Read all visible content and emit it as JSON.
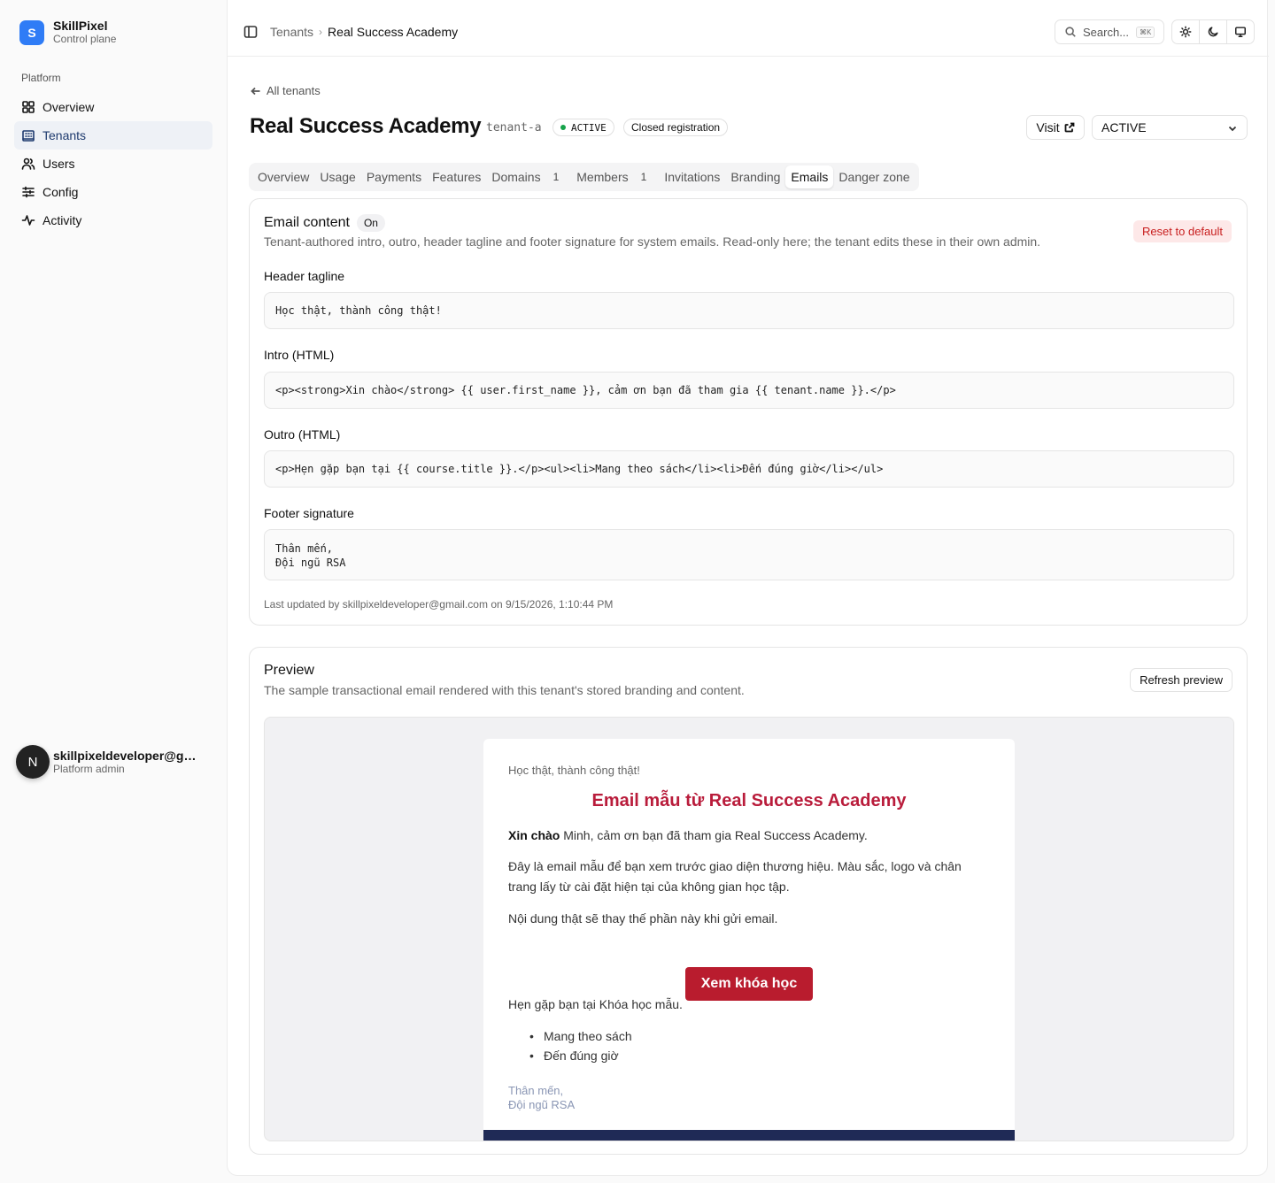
{
  "brand": {
    "logo_letter": "S",
    "name": "SkillPixel",
    "subtitle": "Control plane",
    "color": "#2f7cf6"
  },
  "sidebar": {
    "group_label": "Platform",
    "items": [
      {
        "label": "Overview",
        "icon": "grid-icon"
      },
      {
        "label": "Tenants",
        "icon": "building-icon",
        "active": true
      },
      {
        "label": "Users",
        "icon": "users-icon"
      },
      {
        "label": "Config",
        "icon": "sliders-icon"
      },
      {
        "label": "Activity",
        "icon": "activity-icon"
      }
    ]
  },
  "user": {
    "initial": "N",
    "email": "skillpixeldeveloper@gmail.com",
    "role": "Platform admin"
  },
  "topbar": {
    "breadcrumb": [
      "Tenants",
      "Real Success Academy"
    ],
    "search_placeholder": "Search...",
    "search_shortcut": "⌘K",
    "theme_buttons": [
      "sun-icon",
      "moon-icon",
      "monitor-icon"
    ]
  },
  "tenant": {
    "back_label": "All tenants",
    "name": "Real Success Academy",
    "slug": "tenant-a",
    "status_badge": "ACTIVE",
    "status_color": "#16a34a",
    "registration_badge": "Closed registration",
    "visit_label": "Visit",
    "status_select_value": "ACTIVE"
  },
  "tabs": [
    {
      "label": "Overview"
    },
    {
      "label": "Usage"
    },
    {
      "label": "Payments"
    },
    {
      "label": "Features"
    },
    {
      "label": "Domains",
      "count": "1"
    },
    {
      "label": "Members",
      "count": "1"
    },
    {
      "label": "Invitations"
    },
    {
      "label": "Branding"
    },
    {
      "label": "Emails",
      "active": true
    },
    {
      "label": "Danger zone"
    }
  ],
  "email_content": {
    "title": "Email content",
    "state_pill": "On",
    "description": "Tenant-authored intro, outro, header tagline and footer signature for system emails. Read-only here; the tenant edits these in their own admin.",
    "reset_label": "Reset to default",
    "fields": {
      "header_tagline": {
        "label": "Header tagline",
        "value": "Học thật, thành công thật!"
      },
      "intro": {
        "label": "Intro (HTML)",
        "value": "<p><strong>Xin chào</strong> {{ user.first_name }}, cảm ơn bạn đã tham gia {{ tenant.name }}.</p>"
      },
      "outro": {
        "label": "Outro (HTML)",
        "value": "<p>Hẹn gặp bạn tại {{ course.title }}.</p><ul><li>Mang theo sách</li><li>Đến đúng giờ</li></ul>"
      },
      "footer_signature": {
        "label": "Footer signature",
        "value": "Thân mến,\nĐội ngũ RSA"
      }
    },
    "last_updated": "Last updated by skillpixeldeveloper@gmail.com on 9/15/2026, 1:10:44 PM"
  },
  "preview": {
    "title": "Preview",
    "description": "The sample transactional email rendered with this tenant's stored branding and content.",
    "refresh_label": "Refresh preview",
    "email": {
      "tagline": "Học thật, thành công thật!",
      "heading": "Email mẫu từ Real Success Academy",
      "heading_color": "#b91c3b",
      "greeting_strong": "Xin chào",
      "greeting_rest": " Minh, cảm ơn bạn đã tham gia Real Success Academy.",
      "body1": "Đây là email mẫu để bạn xem trước giao diện thương hiệu. Màu sắc, logo và chân trang lấy từ cài đặt hiện tại của không gian học tập.",
      "body2": "Nội dung thật sẽ thay thế phần này khi gửi email.",
      "cta_label": "Xem khóa học",
      "cta_color": "#b91c2e",
      "outro": "Hẹn gặp bạn tại Khóa học mẫu.",
      "list": [
        "Mang theo sách",
        "Đến đúng giờ"
      ],
      "sign_line1": "Thân mến,",
      "sign_line2": "Đội ngũ RSA",
      "footer_color": "#1f2a56"
    }
  }
}
